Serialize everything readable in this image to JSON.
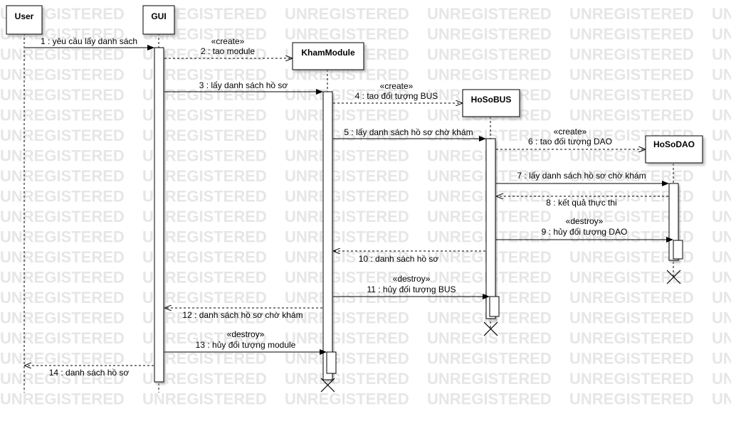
{
  "watermark": "UNREGISTERED",
  "participants": [
    {
      "id": "user",
      "name": "User"
    },
    {
      "id": "gui",
      "name": "GUI"
    },
    {
      "id": "kham",
      "name": "KhamModule"
    },
    {
      "id": "bus",
      "name": "HoSoBUS"
    },
    {
      "id": "dao",
      "name": "HoSoDAO"
    }
  ],
  "messages": [
    {
      "label": "1 : yêu cầu lấy danh sách"
    },
    {
      "stereotype": "«create»",
      "label": "2 : tao module"
    },
    {
      "label": "3 : lấy danh sách hồ sơ"
    },
    {
      "stereotype": "«create»",
      "label": "4 : tao đối tượng BUS"
    },
    {
      "label": "5 : lấy danh sách hồ sơ chờ khám"
    },
    {
      "stereotype": "«create»",
      "label": "6 : tao đối tượng DAO"
    },
    {
      "label": "7 : lấy danh sách hồ sơ chờ khám"
    },
    {
      "label": "8 : kết quả thực thi"
    },
    {
      "stereotype": "«destroy»",
      "label": "9 : hủy đối tượng DAO"
    },
    {
      "label": "10 : danh sách hồ sơ"
    },
    {
      "stereotype": "«destroy»",
      "label": "11 : hủy đối tượng BUS"
    },
    {
      "label": "12 : danh sách hồ sơ chờ khám"
    },
    {
      "stereotype": "«destroy»",
      "label": "13 : hủy đối tượng module"
    },
    {
      "label": "14 : danh sách hồ sơ"
    }
  ]
}
